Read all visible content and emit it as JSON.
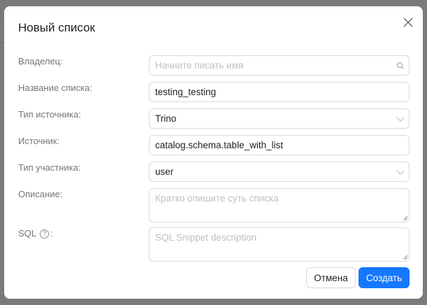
{
  "dialog": {
    "title": "Новый список",
    "close_icon": "close-icon"
  },
  "fields": [
    {
      "label": "Владелец:",
      "placeholder": "Начните писать имя",
      "value": "",
      "icon": "search-icon"
    },
    {
      "label": "Название списка:",
      "value": "testing_testing"
    },
    {
      "label": "Тип источника:",
      "value": "Trino",
      "icon": "chevron-down-icon"
    },
    {
      "label": "Источник:",
      "value": "catalog.schema.table_with_list"
    },
    {
      "label": "Тип участника:",
      "value": "user",
      "icon": "chevron-down-icon"
    },
    {
      "label": "Описание:",
      "placeholder": "Кратко опишите суть списка",
      "value": ""
    },
    {
      "label": "SQL",
      "suffix": ":",
      "placeholder": "SQL Snippet description",
      "value": "",
      "icon": "help-icon",
      "help_glyph": "?"
    }
  ],
  "buttons": {
    "cancel": "Отмена",
    "create": "Создать"
  },
  "colors": {
    "primary": "#1677ff",
    "overlay": "#7a7a7a"
  }
}
